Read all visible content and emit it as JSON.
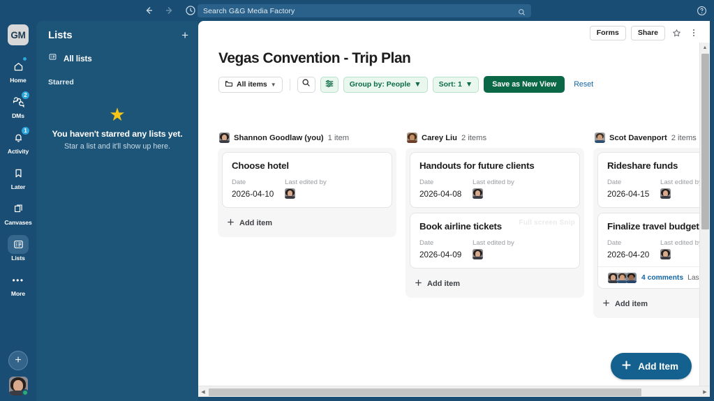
{
  "titlebar": {
    "back_icon": "arrow-left-icon",
    "forward_icon": "arrow-right-icon",
    "history_icon": "clock-icon",
    "search_placeholder": "Search G&G Media Factory",
    "search_icon": "search-icon",
    "help_icon": "question-circle-icon"
  },
  "rail": {
    "workspace_initials": "GM",
    "items": [
      {
        "label": "Home",
        "icon": "home-icon",
        "badge": "",
        "dot": true,
        "active": false
      },
      {
        "label": "DMs",
        "icon": "messages-icon",
        "badge": "2",
        "dot": false,
        "active": false
      },
      {
        "label": "Activity",
        "icon": "bell-icon",
        "badge": "1",
        "dot": false,
        "active": false
      },
      {
        "label": "Later",
        "icon": "bookmark-icon",
        "badge": "",
        "dot": false,
        "active": false
      },
      {
        "label": "Canvases",
        "icon": "canvas-icon",
        "badge": "",
        "dot": false,
        "active": false
      },
      {
        "label": "Lists",
        "icon": "lists-icon",
        "badge": "",
        "dot": false,
        "active": true
      },
      {
        "label": "More",
        "icon": "ellipsis-icon",
        "badge": "",
        "dot": false,
        "active": false
      }
    ],
    "new_button_label": "+",
    "presence": "active"
  },
  "listpane": {
    "title": "Lists",
    "add_label": "+",
    "all_lists_label": "All lists",
    "all_lists_icon": "lists-icon",
    "section_label": "Starred",
    "empty_star_icon": "star-filled-icon",
    "empty_title": "You haven't starred any lists yet.",
    "empty_subtitle": "Star a list and it'll show up here."
  },
  "main": {
    "topbar": {
      "forms_label": "Forms",
      "share_label": "Share",
      "star_icon": "star-outline-icon",
      "more_icon": "kebab-menu-icon"
    },
    "page_title": "Vegas Convention - Trip Plan",
    "viewbar": {
      "all_items_label": "All items",
      "all_items_icon": "folder-icon",
      "search_icon": "search-icon",
      "filter_icon": "sliders-icon",
      "group_by_label": "Group by: People",
      "sort_label": "Sort: 1",
      "save_view_label": "Save as New View",
      "reset_label": "Reset"
    },
    "fab": {
      "label": "Add Item",
      "icon": "plus-icon"
    },
    "add_item_label": "Add item",
    "watermark": "Full screen Snip"
  },
  "board": {
    "columns": [
      {
        "owner": "Shannon Goodlaw (you)",
        "count": "1 item",
        "avatar": "f-w1",
        "cards": [
          {
            "title": "Choose hotel",
            "date_label": "Date",
            "date_value": "2026-04-10",
            "edited_label": "Last edited by",
            "edited_avatar": "f-w1",
            "comments": null
          }
        ]
      },
      {
        "owner": "Carey Liu",
        "count": "2 items",
        "avatar": "f-w2",
        "cards": [
          {
            "title": "Handouts for future clients",
            "date_label": "Date",
            "date_value": "2026-04-08",
            "edited_label": "Last edited by",
            "edited_avatar": "f-w1",
            "comments": null
          },
          {
            "title": "Book airline tickets",
            "date_label": "Date",
            "date_value": "2026-04-09",
            "edited_label": "Last edited by",
            "edited_avatar": "f-w1",
            "comments": null
          }
        ]
      },
      {
        "owner": "Scot Davenport",
        "count": "2 items",
        "avatar": "f-m1",
        "cards": [
          {
            "title": "Rideshare funds",
            "date_label": "Date",
            "date_value": "2026-04-15",
            "edited_label": "Last edited by",
            "edited_avatar": "f-w1",
            "comments": null
          },
          {
            "title": "Finalize travel budget",
            "date_label": "Date",
            "date_value": "2026-04-20",
            "edited_label": "Last edited by",
            "edited_avatar": "f-w1",
            "comments": {
              "link_label": "4 comments",
              "meta": "Last re",
              "faces": [
                "f-w1",
                "f-m1",
                "f-m2"
              ]
            }
          }
        ]
      }
    ]
  },
  "colors": {
    "sidebar": "#1a4d73",
    "listpane": "#1d5578",
    "accent_green": "#0a6847",
    "accent_blue": "#1264a3",
    "fab_blue": "#14618f",
    "star_yellow": "#f5c518",
    "badge_blue": "#2da6dd"
  }
}
